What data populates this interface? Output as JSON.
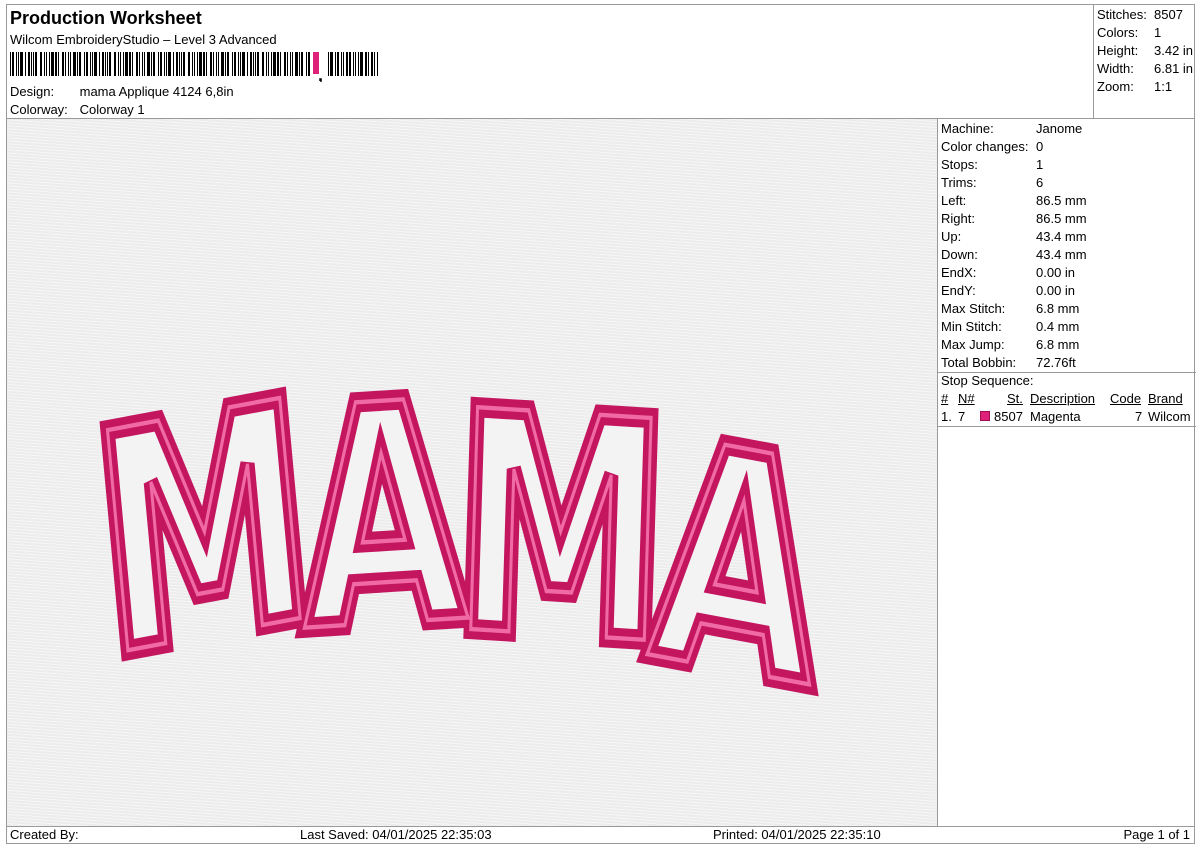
{
  "header": {
    "title": "Production Worksheet",
    "subtitle": "Wilcom EmbroideryStudio – Level 3 Advanced",
    "design_label": "Design:",
    "design_value": "mama Applique 4124 6,8in",
    "colorway_label": "Colorway:",
    "colorway_value": "Colorway 1"
  },
  "stats": [
    {
      "label": "Stitches:",
      "value": "8507"
    },
    {
      "label": "Colors:",
      "value": "1"
    },
    {
      "label": "Height:",
      "value": "3.42 in"
    },
    {
      "label": "Width:",
      "value": "6.81 in"
    },
    {
      "label": "Zoom:",
      "value": "1:1"
    }
  ],
  "design": {
    "text": "MAMA",
    "thread_color": "#e0217a",
    "outline_color": "#c4155f"
  },
  "info": [
    {
      "label": "Machine:",
      "value": "Janome"
    },
    {
      "label": "Color changes:",
      "value": "0"
    },
    {
      "label": "Stops:",
      "value": "1"
    },
    {
      "label": "Trims:",
      "value": "6"
    },
    {
      "label": "Left:",
      "value": "86.5 mm"
    },
    {
      "label": "Right:",
      "value": "86.5 mm"
    },
    {
      "label": "Up:",
      "value": "43.4 mm"
    },
    {
      "label": "Down:",
      "value": "43.4 mm"
    },
    {
      "label": "EndX:",
      "value": "0.00 in"
    },
    {
      "label": "EndY:",
      "value": "0.00 in"
    },
    {
      "label": "Max Stitch:",
      "value": "6.8 mm"
    },
    {
      "label": "Min Stitch:",
      "value": "0.4 mm"
    },
    {
      "label": "Max Jump:",
      "value": "6.8 mm"
    },
    {
      "label": "Total Bobbin:",
      "value": "72.76ft"
    }
  ],
  "stop_sequence": {
    "title": "Stop Sequence:",
    "columns": [
      "#",
      "N#",
      "St.",
      "Description",
      "Code",
      "Brand"
    ],
    "rows": [
      {
        "num": "1.",
        "n": "7",
        "st": "8507",
        "description": "Magenta",
        "code": "7",
        "brand": "Wilcom",
        "swatch": "#e0217a"
      }
    ]
  },
  "footer": {
    "created_by": "Created By:",
    "last_saved": "Last Saved: 04/01/2025 22:35:03",
    "printed": "Printed: 04/01/2025 22:35:10",
    "page": "Page 1 of 1"
  }
}
